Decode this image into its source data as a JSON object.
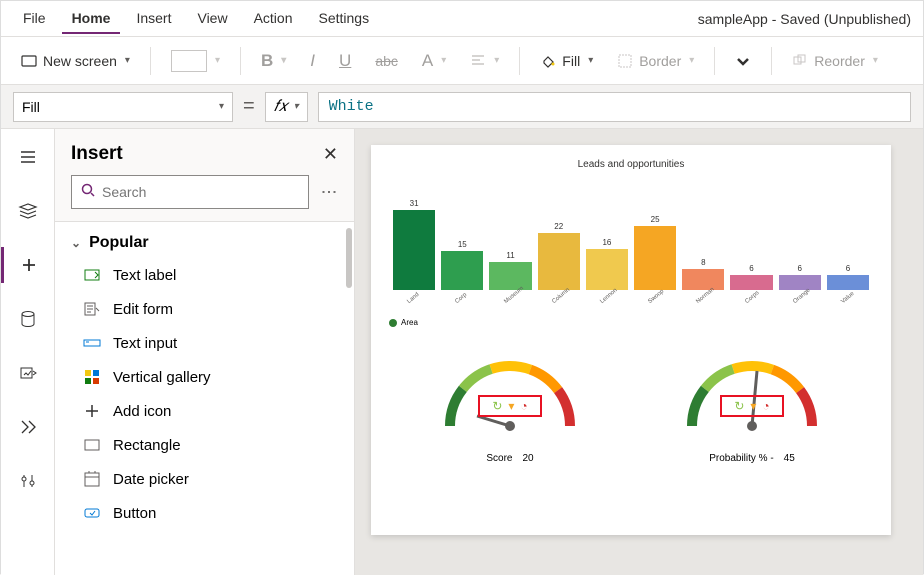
{
  "menubar": {
    "items": [
      "File",
      "Home",
      "Insert",
      "View",
      "Action",
      "Settings"
    ],
    "active_index": 1
  },
  "app_title": "sampleApp - Saved (Unpublished)",
  "ribbon": {
    "new_screen": "New screen",
    "fill": "Fill",
    "border": "Border",
    "reorder": "Reorder"
  },
  "formula": {
    "property": "Fill",
    "fx": "fx",
    "value": "White"
  },
  "insert_pane": {
    "title": "Insert",
    "search_placeholder": "Search",
    "category": "Popular",
    "items": [
      {
        "label": "Text label",
        "icon": "text-label"
      },
      {
        "label": "Edit form",
        "icon": "edit-form"
      },
      {
        "label": "Text input",
        "icon": "text-input"
      },
      {
        "label": "Vertical gallery",
        "icon": "vertical-gallery"
      },
      {
        "label": "Add icon",
        "icon": "add-icon"
      },
      {
        "label": "Rectangle",
        "icon": "rectangle"
      },
      {
        "label": "Date picker",
        "icon": "date-picker"
      },
      {
        "label": "Button",
        "icon": "button"
      }
    ]
  },
  "chart_data": {
    "type": "bar",
    "title": "Leads and opportunities",
    "categories": [
      "Land",
      "Corp",
      "Museum",
      "Column",
      "Lennon",
      "Swoop",
      "Norman",
      "Corps",
      "Orange",
      "Value"
    ],
    "values": [
      31,
      15,
      11,
      22,
      16,
      25,
      8,
      6,
      6,
      6
    ],
    "ylim": [
      0,
      35
    ],
    "legend": "Area"
  },
  "gauges": [
    {
      "label": "Score",
      "value": 20
    },
    {
      "label": "Probability % -",
      "value": 45
    }
  ]
}
